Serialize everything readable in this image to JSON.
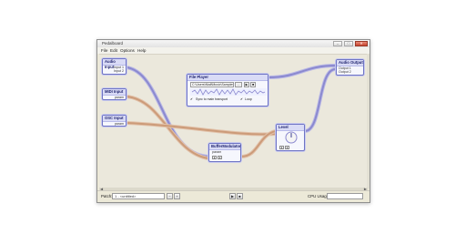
{
  "window": {
    "title": "Pedalboard"
  },
  "menu": [
    "File",
    "Edit",
    "Options",
    "Help"
  ],
  "colors": {
    "audio_wire": "#8b89cf",
    "midi_wire": "#cc9b79",
    "node_border": "#6f74c4",
    "node_header": "#d9dbf6"
  },
  "nodes": {
    "audio_input": {
      "title": "Audio Input",
      "ports": [
        "Input 1",
        "Input 2"
      ]
    },
    "midi_input": {
      "title": "MIDI Input",
      "ports": [
        "param"
      ]
    },
    "osc_input": {
      "title": "OSC Input",
      "ports": [
        "param"
      ]
    },
    "file_player": {
      "title": "File Player",
      "path": "C:\\Users\\Niall\\Music\\Samples\\Some...",
      "browse_label": "...",
      "sync_label": "Sync to main transport",
      "loop_label": "Loop"
    },
    "buffer_modulator": {
      "title": "BufferModulator",
      "ports": [
        "param"
      ]
    },
    "level": {
      "title": "Level"
    },
    "audio_output": {
      "title": "Audio Output",
      "ports": [
        "Output 1",
        "Output 2"
      ]
    }
  },
  "bottom": {
    "patch_label": "Patch:",
    "patch_value": "1 - <untitled>",
    "cpu_label": "CPU Usage:"
  },
  "icons": [
    "play-icon",
    "stop-icon",
    "minimize-icon",
    "maximize-icon",
    "close-icon"
  ]
}
